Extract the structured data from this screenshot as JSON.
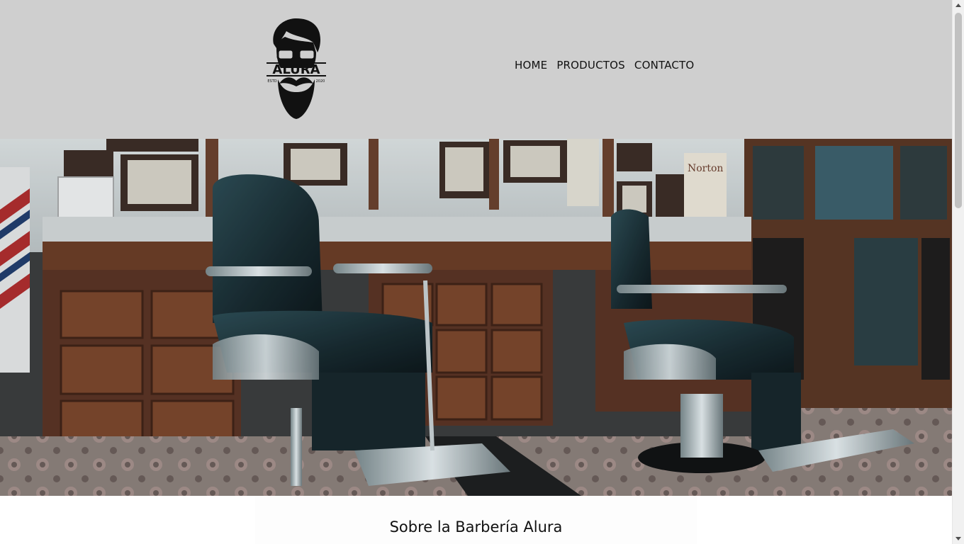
{
  "header": {
    "logo": {
      "icon": "barber-logo-icon",
      "text": "ALURA",
      "left_text": "ESTD",
      "right_text": "2020"
    },
    "nav": [
      {
        "label": "HOME"
      },
      {
        "label": "PRODUCTOS"
      },
      {
        "label": "CONTACTO"
      }
    ]
  },
  "hero": {
    "icon": "barbershop-photo"
  },
  "about": {
    "title": "Sobre la Barbería Alura"
  },
  "colors": {
    "header_bg": "#cfcfcf",
    "text": "#111111"
  }
}
